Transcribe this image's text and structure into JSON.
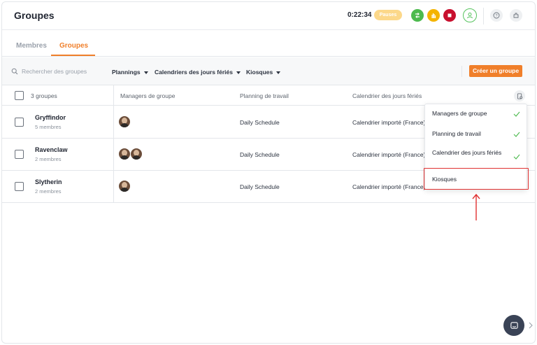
{
  "header": {
    "title": "Groupes",
    "timer": "0:22:34",
    "pause_label": "Pauses"
  },
  "tabs": [
    {
      "label": "Membres",
      "active": false
    },
    {
      "label": "Groupes",
      "active": true
    }
  ],
  "filters": {
    "search_placeholder": "Rechercher des groupes",
    "plannings": "Plannings",
    "holidays": "Calendriers des jours fériés",
    "kiosks": "Kiosques",
    "create_button": "Créer un groupe"
  },
  "table": {
    "count_label": "3 groupes",
    "columns": [
      "Managers de groupe",
      "Planning de travail",
      "Calendrier des jours fériés"
    ],
    "rows": [
      {
        "name": "Gryffindor",
        "members": "5 membres",
        "managers": 1,
        "schedule": "Daily Schedule",
        "calendar": "Calendrier importé (France)"
      },
      {
        "name": "Ravenclaw",
        "members": "2 membres",
        "managers": 2,
        "schedule": "Daily Schedule",
        "calendar": "Calendrier importé (France)"
      },
      {
        "name": "Slytherin",
        "members": "2 membres",
        "managers": 1,
        "schedule": "Daily Schedule",
        "calendar": "Calendrier importé (France)"
      }
    ]
  },
  "column_menu": {
    "items": [
      {
        "label": "Managers de groupe",
        "checked": true
      },
      {
        "label": "Planning de travail",
        "checked": true
      },
      {
        "label": "Calendrier des jours fériés",
        "checked": true
      },
      {
        "label": "Kiosques",
        "checked": false
      }
    ]
  },
  "colors": {
    "accent": "#f07f2a",
    "highlight": "#e03131",
    "check": "#4cba4e"
  }
}
